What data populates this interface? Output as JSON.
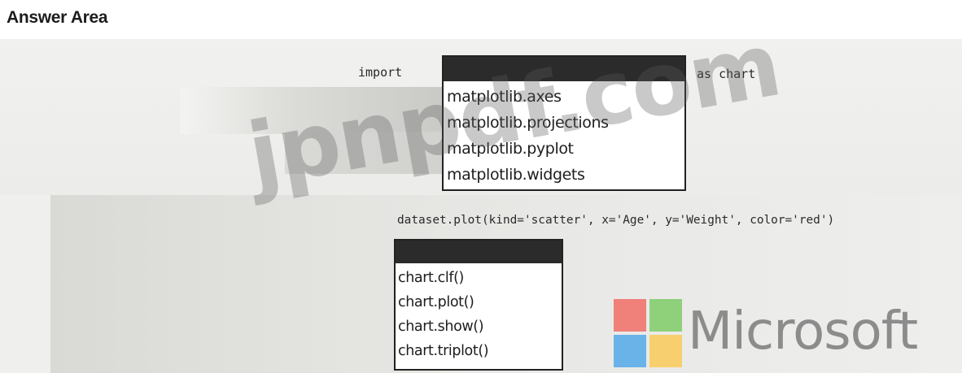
{
  "header": {
    "title": "Answer Area"
  },
  "code": {
    "import_keyword": "import",
    "as_clause": "as chart",
    "plot_line": "dataset.plot(kind='scatter', x='Age', y='Weight', color='red')"
  },
  "dropdown_import": {
    "options": [
      "matplotlib.axes",
      "matplotlib.projections",
      "matplotlib.pyplot",
      "matplotlib.widgets"
    ]
  },
  "dropdown_chart": {
    "options": [
      "chart.clf()",
      "chart.plot()",
      "chart.show()",
      "chart.triplot()"
    ]
  },
  "watermark": {
    "text": "jpnpdf.com"
  },
  "logo": {
    "wordmark": "Microsoft",
    "colors": {
      "red": "#f0807a",
      "green": "#8fd07a",
      "blue": "#6ab3e8",
      "yellow": "#f7cf6f"
    }
  }
}
